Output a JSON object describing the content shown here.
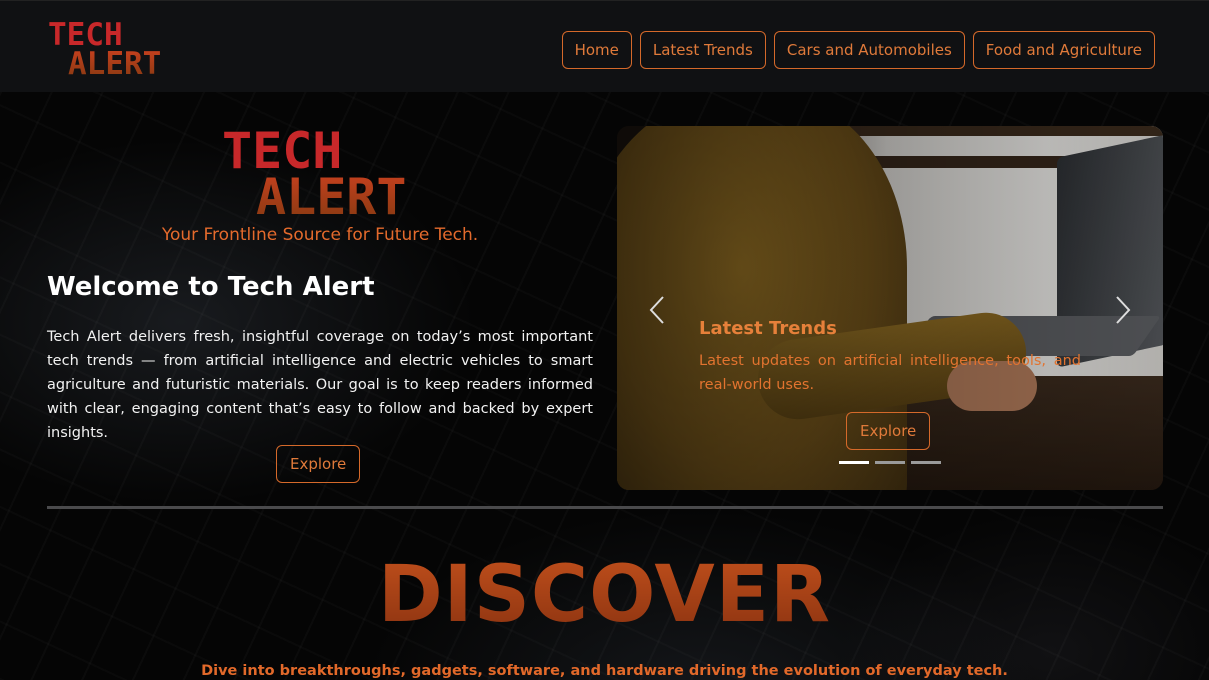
{
  "header": {
    "logo_line1": "TECH",
    "logo_line2": "ALERT",
    "nav": [
      {
        "label": "Home"
      },
      {
        "label": "Latest Trends"
      },
      {
        "label": "Cars and Automobiles"
      },
      {
        "label": "Food and Agriculture"
      }
    ]
  },
  "hero": {
    "logo_line1": "TECH",
    "logo_line2": "ALERT",
    "tagline": "Your Frontline Source for Future Tech.",
    "heading": "Welcome to Tech Alert",
    "description": "Tech Alert delivers fresh, insightful coverage on today’s most important tech trends — from artificial intelligence and electric vehicles to smart agriculture and futuristic materials. Our goal is to keep readers informed with clear, engaging content that’s easy to follow and backed by expert insights.",
    "explore_label": "Explore"
  },
  "carousel": {
    "slide_title": "Latest Trends",
    "slide_description": "Latest updates on artificial intelligence, tools, and real-world uses.",
    "explore_label": "Explore",
    "indicator_count": 3,
    "active_index": 0
  },
  "discover": {
    "title": "DISCOVER",
    "subtitle": "Dive into breakthroughs, gadgets, software, and hardware driving the evolution of everyday tech."
  },
  "colors": {
    "accent": "#e07a3a",
    "logo_red": "#c8282a",
    "header_bg": "#101113"
  }
}
